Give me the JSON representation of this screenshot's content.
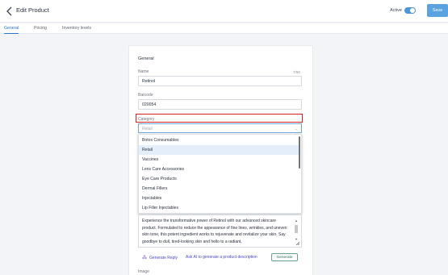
{
  "header": {
    "title": "Edit Product",
    "active_label": "Active",
    "active": true,
    "save_label": "Save"
  },
  "tabs": [
    {
      "label": "General",
      "active": true
    },
    {
      "label": "Pricing",
      "active": false
    },
    {
      "label": "Inventory levels",
      "active": false
    }
  ],
  "form": {
    "section_title": "General",
    "name": {
      "label": "Name",
      "value": "Retinol",
      "counter": "7/50"
    },
    "barcode": {
      "label": "Barcode",
      "value": "020054"
    },
    "category": {
      "label": "Category",
      "placeholder": "Retail",
      "options": [
        "Botox Consumables",
        "Retail",
        "Vaccines",
        "Lens Care Accessories",
        "Eye Care Products",
        "Dermal Fillers",
        "Injectables",
        "Lip Filler Injectables"
      ],
      "selected": "Retail"
    },
    "description": {
      "text": "Experience the transformative power of Retinol with our advanced skincare product. Formulated to reduce the appearance of fine lines, wrinkles, and uneven skin tone, this potent ingredient works to rejuvenate and revitalize your skin. Say goodbye to dull, tired-looking skin and hello to a radiant,"
    },
    "ai": {
      "generate_reply": "Generate Reply",
      "hint": "Ask AI to generate a product description",
      "generate_button": "Generate"
    },
    "image_label": "Image"
  },
  "colors": {
    "accent": "#2a76c9",
    "save_button": "#5aa3e0",
    "highlight": "#d81e1e",
    "ai": "#4a49c8"
  }
}
